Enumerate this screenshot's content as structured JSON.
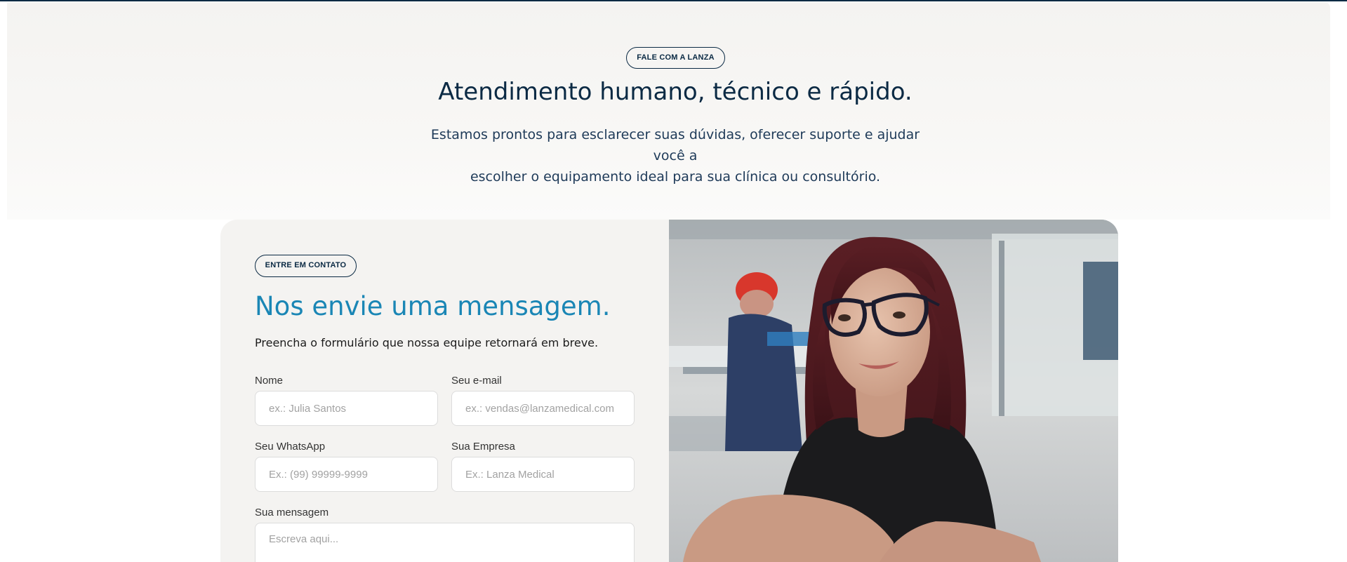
{
  "hero": {
    "badge": "FALE COM A LANZA",
    "title": "Atendimento humano, técnico e rápido.",
    "subtitle_line1": "Estamos prontos para esclarecer suas dúvidas, oferecer suporte e ajudar você a",
    "subtitle_line2": "escolher o equipamento ideal para sua clínica ou consultório."
  },
  "form": {
    "badge": "ENTRE EM CONTATO",
    "title": "Nos envie uma mensagem.",
    "subtitle": "Preencha o formulário que nossa equipe retornará em breve.",
    "fields": {
      "name": {
        "label": "Nome",
        "placeholder": "ex.: Julia Santos",
        "value": ""
      },
      "email": {
        "label": "Seu e-mail",
        "placeholder": "ex.: vendas@lanzamedical.com",
        "value": ""
      },
      "whatsapp": {
        "label": "Seu WhatsApp",
        "placeholder": "Ex.: (99) 99999-9999",
        "value": ""
      },
      "company": {
        "label": "Sua Empresa",
        "placeholder": "Ex.: Lanza Medical",
        "value": ""
      },
      "message": {
        "label": "Sua mensagem",
        "placeholder": "Escreva aqui...",
        "value": ""
      }
    }
  },
  "photo": {
    "alt": "woman-with-glasses-portrait"
  },
  "colors": {
    "navy": "#0b2a44",
    "accent_blue": "#1a86b5",
    "panel_bg": "#f4f3f1"
  }
}
